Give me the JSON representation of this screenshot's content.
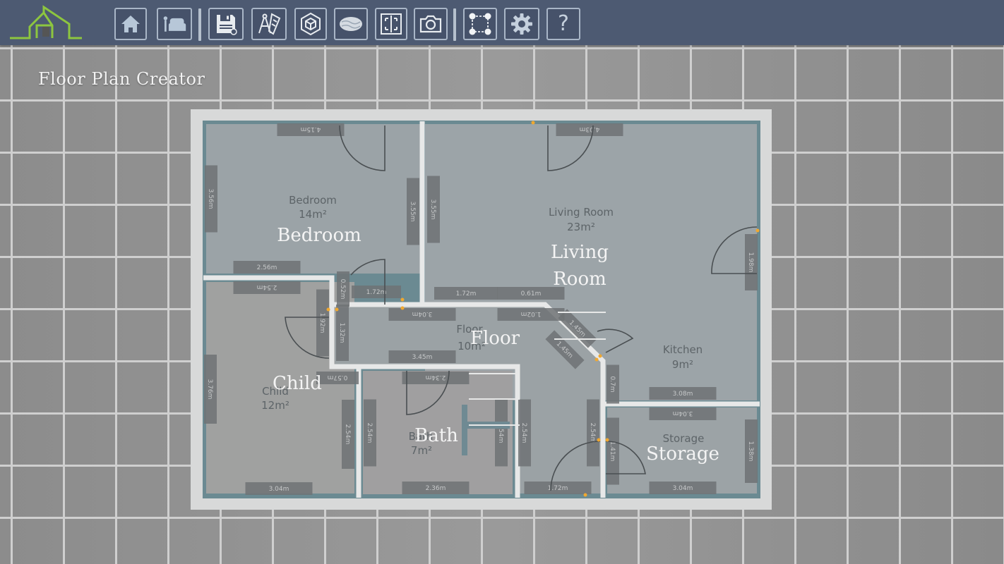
{
  "app": {
    "title": "Floor Plan Creator",
    "logo_icon": "house-outline-logo-icon",
    "accent_color": "#8dc63f",
    "toolbar_color": "#4d5a72"
  },
  "toolbar": {
    "buttons": [
      {
        "name": "home",
        "icon": "home-icon"
      },
      {
        "name": "furniture",
        "icon": "lamp-armchair-icon"
      },
      {
        "name": "save",
        "icon": "floppy-disk-icon"
      },
      {
        "name": "drawing-tools",
        "icon": "compass-ruler-icon"
      },
      {
        "name": "3d-view",
        "icon": "cube-icon"
      },
      {
        "name": "texture",
        "icon": "texture-swatch-icon"
      },
      {
        "name": "fit-view",
        "icon": "fit-screen-icon"
      },
      {
        "name": "screenshot",
        "icon": "camera-icon"
      },
      {
        "name": "select-corners",
        "icon": "corner-nodes-icon"
      },
      {
        "name": "settings",
        "icon": "gear-icon"
      },
      {
        "name": "help",
        "icon": "question-mark-icon",
        "label": "?"
      }
    ]
  },
  "rooms": [
    {
      "id": "bedroom",
      "label": "Bedroom",
      "name": "Bedroom",
      "area": "14m²"
    },
    {
      "id": "living",
      "label_line1": "Living",
      "label_line2": "Room",
      "name": "Living Room",
      "area": "23m²"
    },
    {
      "id": "kitchen",
      "name": "Kitchen",
      "area": "9m²"
    },
    {
      "id": "floor",
      "label": "Floor",
      "name": "Floor",
      "area": "10m²"
    },
    {
      "id": "child",
      "label": "Child",
      "name": "Child",
      "area": "12m²"
    },
    {
      "id": "bath",
      "label": "Bath",
      "name": "Bath",
      "area": "7m²"
    },
    {
      "id": "storage",
      "label": "Storage",
      "name": "Storage",
      "area": ""
    }
  ],
  "dimensions": {
    "bedroom_top": "4.15m",
    "bedroom_left": "3.56m",
    "bedroom_right": "3.55m",
    "bedroom_bottom": "2.56m",
    "living_top": "4.03m",
    "living_left": "3.55m",
    "living_right": "1.98m",
    "hall_a": "1.72m",
    "hall_b": "1.72m",
    "hall_c": "0.61m",
    "hall_d": "0.52m",
    "floor_top": "3.04m",
    "floor_top2": "1.02m",
    "floor_bottom": "3.45m",
    "diag_a": "1.45m",
    "diag_b": "1.45m",
    "kitchen_left": "0.7m",
    "kitchen_bottom": "3.08m",
    "child_top": "2.54m",
    "child_left": "3.76m",
    "child_door": "1.92m",
    "child_right": "2.54m",
    "child_bottom": "3.04m",
    "child_inner": "0.57m",
    "floor_left": "1.32m",
    "bath_top": "2.34m",
    "bath_left": "2.54m",
    "bath_right": "2.54m",
    "bath_right2": "2.54m",
    "bath_bottom": "2.36m",
    "corridor_bottom": "1.72m",
    "corridor_right": "2.54m",
    "storage_top": "3.04m",
    "storage_left": "1.41m",
    "storage_right": "1.38m",
    "storage_bottom": "3.04m"
  }
}
